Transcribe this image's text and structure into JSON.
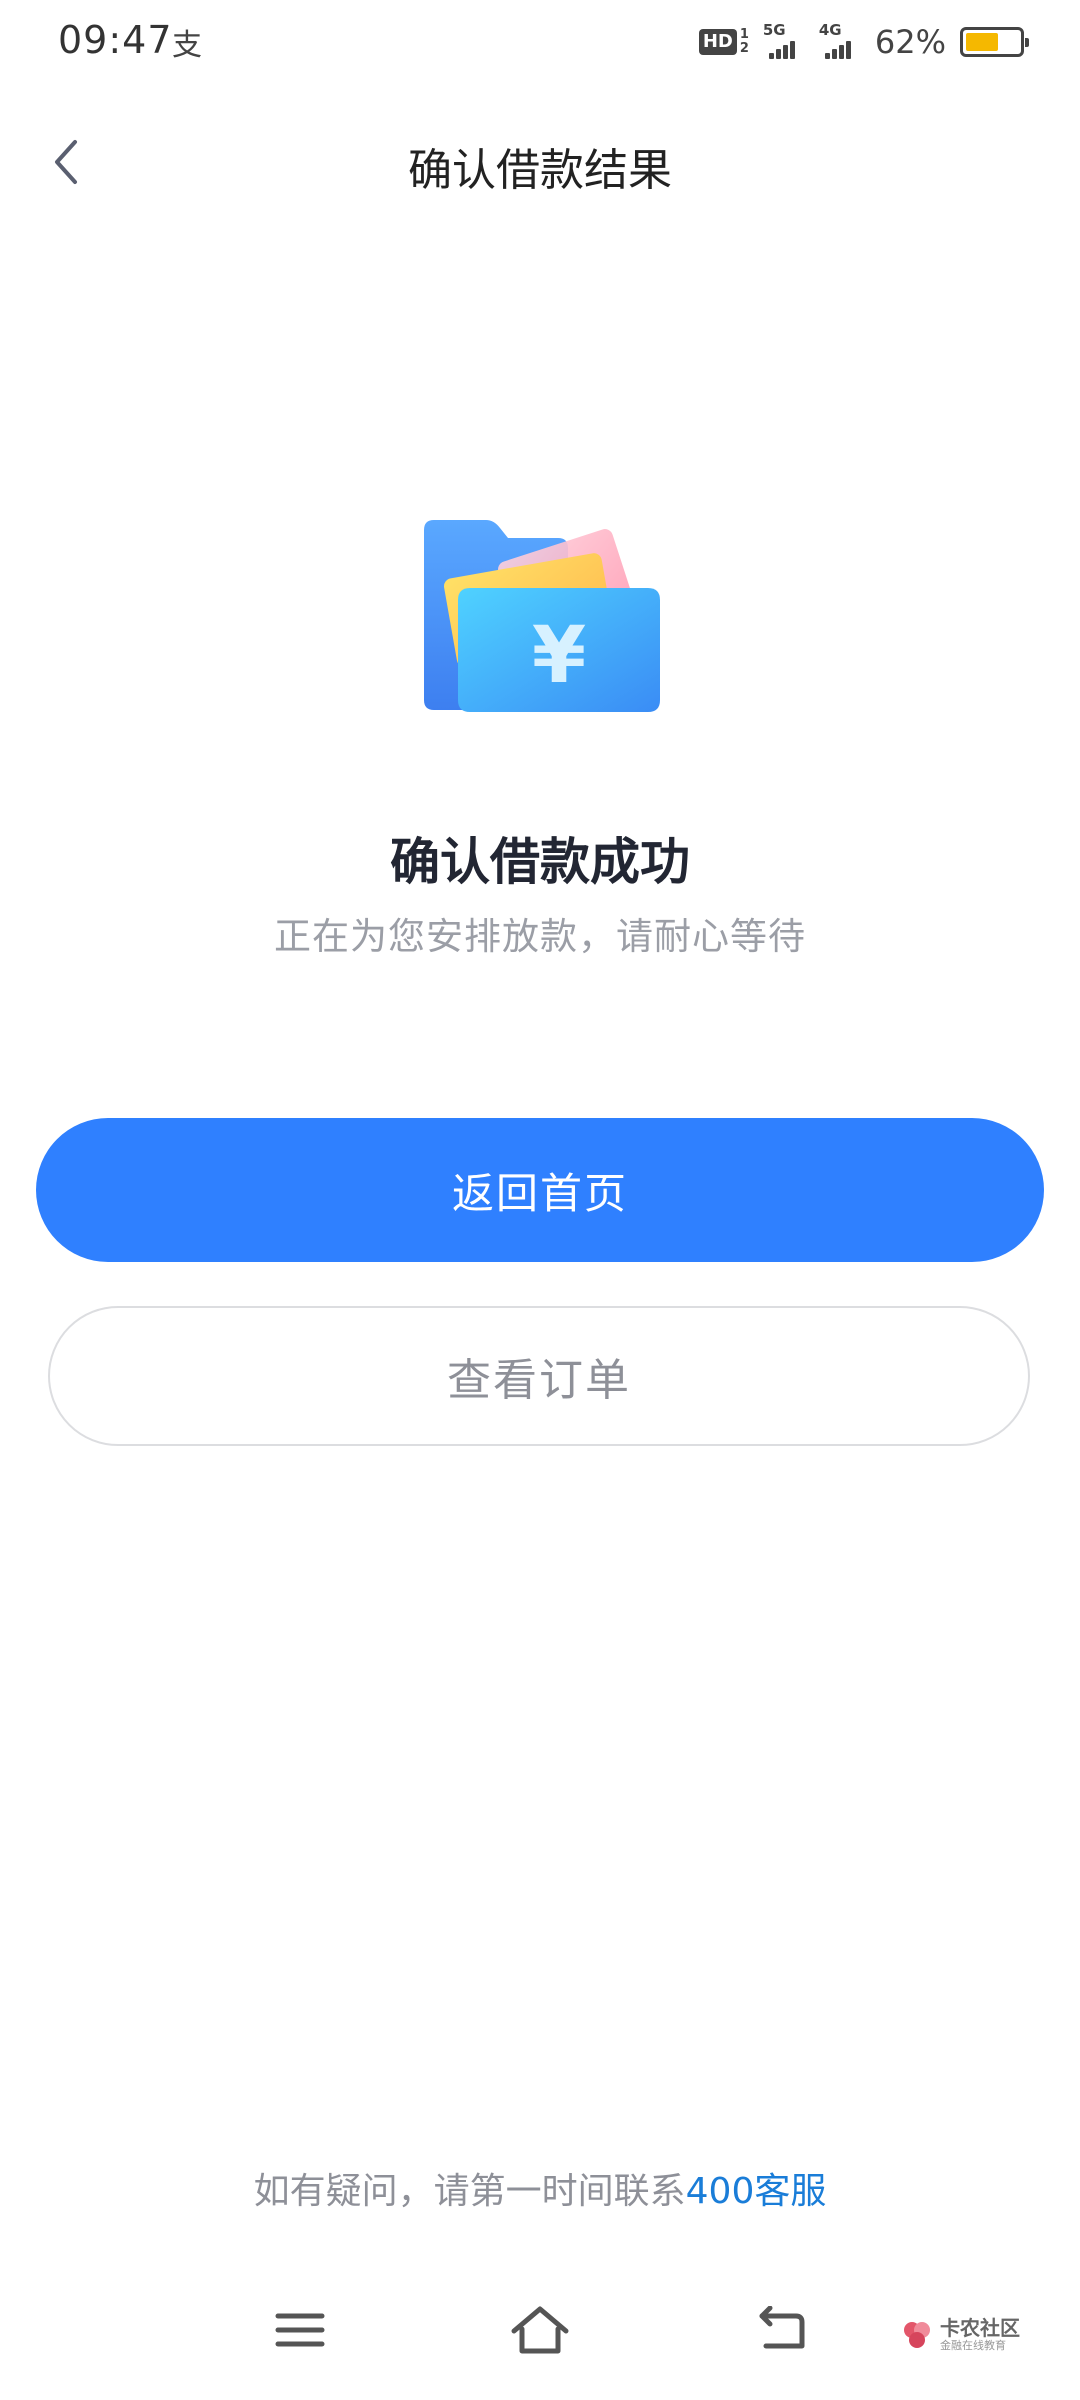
{
  "status_bar": {
    "time": "09:47",
    "alipay_glyph": "支",
    "hd_label": "HD",
    "hd_sub_top": "1",
    "hd_sub_bottom": "2",
    "signal1_label": "5G",
    "signal2_label": "4G",
    "battery_percent": "62%",
    "battery_level": 0.62,
    "battery_color": "#f5b800"
  },
  "header": {
    "back_icon": "chevron-left-icon",
    "title": "确认借款结果"
  },
  "result": {
    "illustration": "wallet-yuan-icon",
    "title": "确认借款成功",
    "subtitle": "正在为您安排放款，请耐心等待"
  },
  "actions": {
    "primary_label": "返回首页",
    "secondary_label": "查看订单",
    "primary_color": "#2f80ff"
  },
  "help": {
    "prefix": "如有疑问，请第一时间联系",
    "link": "400客服",
    "link_color": "#1a7dd8"
  },
  "nav": {
    "menu_icon": "menu-icon",
    "home_icon": "home-icon",
    "back_icon": "back-arrow-icon"
  },
  "watermark": {
    "main": "卡农社区",
    "sub": "金融在线教育"
  }
}
